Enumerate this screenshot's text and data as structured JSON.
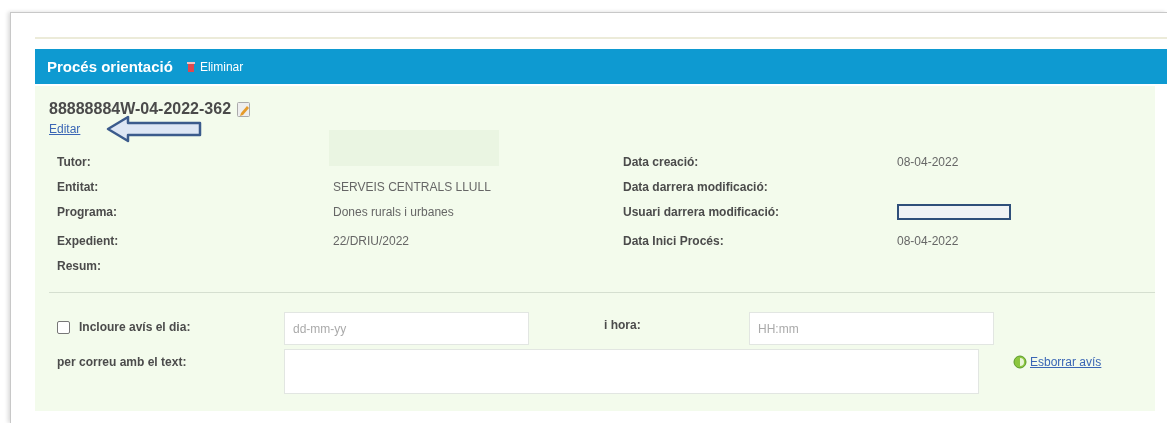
{
  "panel": {
    "title": "Procés orientació",
    "delete_link": "Eliminar"
  },
  "record": {
    "id": "88888884W-04-2022-362",
    "edit_link": "Editar"
  },
  "details": [
    {
      "label": "Tutor:",
      "kind": "blurred"
    },
    {
      "label": "Data creació:",
      "kind": "text",
      "value": "08-04-2022"
    },
    {
      "label": "Entitat:",
      "kind": "text",
      "value": "SERVEIS CENTRALS LLULL"
    },
    {
      "label": "Data darrera modificació:",
      "kind": "empty"
    },
    {
      "label": "Programa:",
      "kind": "text",
      "value": "Dones rurals i urbanes"
    },
    {
      "label": "Usuari darrera modificació:",
      "kind": "redacted"
    },
    {
      "label": "Expedient:",
      "kind": "text",
      "value": "22/DRIU/2022"
    },
    {
      "label": "Data Inici Procés:",
      "kind": "text",
      "value": "08-04-2022"
    },
    {
      "label": "Resum:",
      "kind": "empty"
    }
  ],
  "reminder": {
    "checked": false,
    "label": "Incloure avís el dia:",
    "date_placeholder": "dd-mm-yy",
    "time_label": "i hora:",
    "time_placeholder": "HH:mm",
    "text_label": "per correu amb el text:",
    "delete_link": "Esborrar avís"
  }
}
